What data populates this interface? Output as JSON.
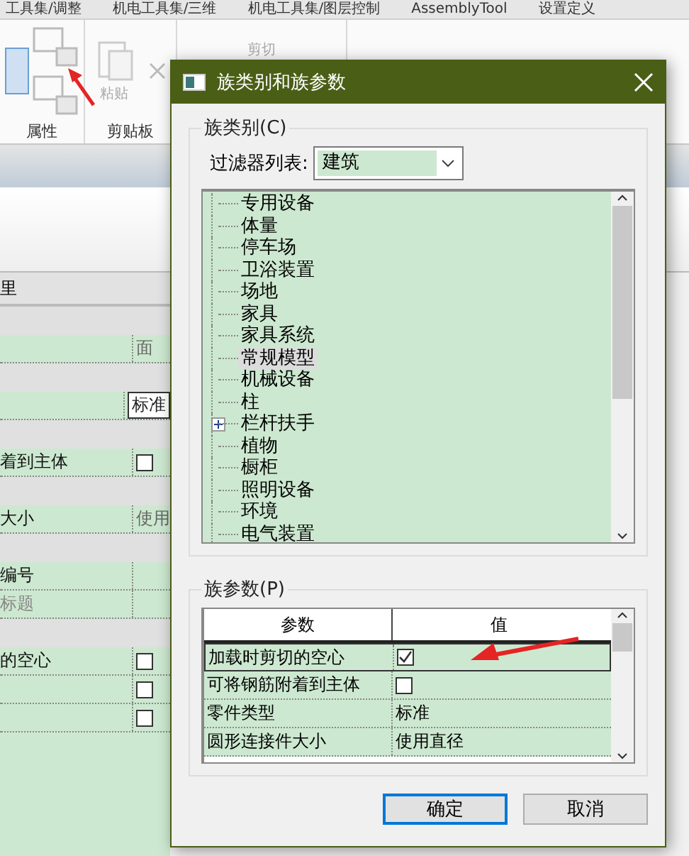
{
  "ribbon": {
    "tabs": [
      "工具集/调整",
      "机电工具集/三维",
      "机电工具集/图层控制",
      "AssemblyTool",
      "设置定义"
    ],
    "groups": [
      {
        "label": "属性"
      },
      {
        "label": "剪贴板"
      }
    ],
    "paste_label": "粘贴",
    "cut_label": "剪切"
  },
  "properties_panel": {
    "header": "里",
    "rows": [
      {
        "kind": "group"
      },
      {
        "kind": "text",
        "value": "面"
      },
      {
        "kind": "group"
      },
      {
        "kind": "select",
        "value": "标准"
      },
      {
        "kind": "group"
      },
      {
        "kind": "check",
        "label": "着到主体",
        "checked": false
      },
      {
        "kind": "group"
      },
      {
        "kind": "text",
        "label": "大小",
        "value": "使用"
      },
      {
        "kind": "group"
      },
      {
        "kind": "text",
        "label": "编号",
        "disabled": false
      },
      {
        "kind": "text",
        "label": "标题",
        "disabled": true
      },
      {
        "kind": "group"
      },
      {
        "kind": "check",
        "label": "的空心",
        "checked": false
      },
      {
        "kind": "check",
        "checked": false
      },
      {
        "kind": "check",
        "checked": false
      }
    ]
  },
  "dialog": {
    "title": "族类别和族参数",
    "category_group": {
      "legend": "族类别(C)",
      "filter_label": "过滤器列表:",
      "filter_value": "建筑",
      "items": [
        {
          "label": "专用设备",
          "selected": false,
          "expandable": false
        },
        {
          "label": "体量",
          "selected": false,
          "expandable": false
        },
        {
          "label": "停车场",
          "selected": false,
          "expandable": false
        },
        {
          "label": "卫浴装置",
          "selected": false,
          "expandable": false
        },
        {
          "label": "场地",
          "selected": false,
          "expandable": false
        },
        {
          "label": "家具",
          "selected": false,
          "expandable": false
        },
        {
          "label": "家具系统",
          "selected": false,
          "expandable": false
        },
        {
          "label": "常规模型",
          "selected": true,
          "expandable": false
        },
        {
          "label": "机械设备",
          "selected": false,
          "expandable": false
        },
        {
          "label": "柱",
          "selected": false,
          "expandable": false
        },
        {
          "label": "栏杆扶手",
          "selected": false,
          "expandable": true
        },
        {
          "label": "植物",
          "selected": false,
          "expandable": false
        },
        {
          "label": "橱柜",
          "selected": false,
          "expandable": false
        },
        {
          "label": "照明设备",
          "selected": false,
          "expandable": false
        },
        {
          "label": "环境",
          "selected": false,
          "expandable": false
        },
        {
          "label": "电气装置",
          "selected": false,
          "expandable": false
        }
      ]
    },
    "params_group": {
      "legend": "族参数(P)",
      "columns": [
        "参数",
        "值"
      ],
      "rows": [
        {
          "name": "加载时剪切的空心",
          "kind": "check",
          "checked": true,
          "selected": true
        },
        {
          "name": "可将钢筋附着到主体",
          "kind": "check",
          "checked": false,
          "selected": false
        },
        {
          "name": "零件类型",
          "kind": "text",
          "value": "标准",
          "selected": false
        },
        {
          "name": "圆形连接件大小",
          "kind": "text",
          "value": "使用直径",
          "selected": false
        }
      ]
    },
    "buttons": [
      {
        "label": "确定",
        "default": true
      },
      {
        "label": "取消",
        "default": false
      }
    ]
  }
}
